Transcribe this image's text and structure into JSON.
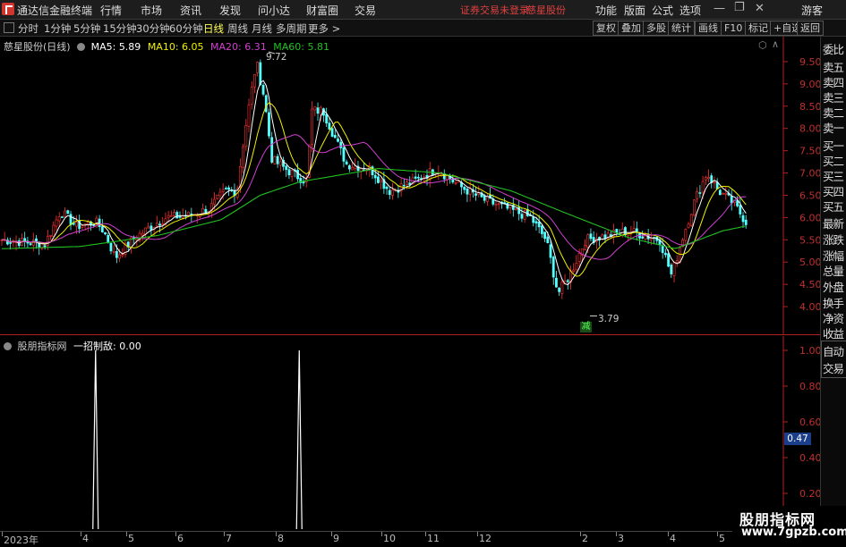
{
  "app": {
    "title": "通达信金融终端"
  },
  "menu": [
    "行情",
    "市场",
    "资讯",
    "发现",
    "问小达",
    "财富圈",
    "交易"
  ],
  "notice": {
    "trade": "证券交易未登录",
    "stock": "慈星股份"
  },
  "right_menu": [
    "功能",
    "版面",
    "公式",
    "选项"
  ],
  "guest": "游客",
  "periods": [
    "分时",
    "1分钟",
    "5分钟",
    "15分钟",
    "30分钟",
    "60分钟",
    "日线",
    "周线",
    "月线",
    "多周期",
    "更多 >"
  ],
  "active_period": "日线",
  "tool_buttons": [
    "复权",
    "叠加",
    "多股",
    "统计",
    "画线",
    "F10",
    "标记",
    "+自选",
    "返回"
  ],
  "right_panel": [
    "委比",
    "卖五",
    "卖四",
    "卖三",
    "卖二",
    "卖一",
    "买一",
    "买二",
    "买三",
    "买四",
    "买五",
    "最新",
    "涨跌",
    "涨幅",
    "总量",
    "外盘",
    "换手",
    "净资",
    "收益",
    "自动",
    "交易"
  ],
  "main_chart": {
    "stock_label": "慈星股份(日线)",
    "ma": [
      {
        "name": "MA5",
        "value": "5.89",
        "color": "#ffffff"
      },
      {
        "name": "MA10",
        "value": "6.05",
        "color": "#f0f000"
      },
      {
        "name": "MA20",
        "value": "6.31",
        "color": "#d040d0"
      },
      {
        "name": "MA60",
        "value": "5.81",
        "color": "#20c020"
      }
    ],
    "price_ticks": [
      "9.50",
      "9.00",
      "8.50",
      "8.00",
      "7.50",
      "7.00",
      "6.50",
      "6.00",
      "5.50",
      "5.00",
      "4.50",
      "4.00"
    ],
    "high_label": "9.72",
    "low_label": "3.79",
    "reduce_mark": "减"
  },
  "sub_chart": {
    "indicator_label": "股朋指标网",
    "formula_label": "一招制敌: 0.00",
    "ticks": [
      "1.00",
      "0.80",
      "0.60",
      "0.40",
      "0.20"
    ],
    "current_value": "0.47"
  },
  "x_axis": [
    "2023年",
    "4",
    "5",
    "6",
    "7",
    "8",
    "9",
    "10",
    "11",
    "12",
    "2",
    "3",
    "4",
    "5"
  ],
  "watermark": {
    "line1": "股朋指标网",
    "line2": "www.7gpzb.com"
  },
  "chart_data": {
    "type": "line",
    "title": "慈星股份(日线)",
    "ylim": [
      3.6,
      9.9
    ],
    "annotations": {
      "high": 9.72,
      "low": 3.79
    },
    "ma_latest": {
      "MA5": 5.89,
      "MA10": 6.05,
      "MA20": 6.31,
      "MA60": 5.81
    },
    "close_path": [
      {
        "x": 0.0,
        "y": 5.5
      },
      {
        "x": 0.03,
        "y": 5.45
      },
      {
        "x": 0.055,
        "y": 5.4
      },
      {
        "x": 0.075,
        "y": 6.15
      },
      {
        "x": 0.095,
        "y": 5.8
      },
      {
        "x": 0.12,
        "y": 5.9
      },
      {
        "x": 0.13,
        "y": 5.7
      },
      {
        "x": 0.145,
        "y": 5.1
      },
      {
        "x": 0.17,
        "y": 5.55
      },
      {
        "x": 0.195,
        "y": 5.85
      },
      {
        "x": 0.21,
        "y": 6.0
      },
      {
        "x": 0.24,
        "y": 6.05
      },
      {
        "x": 0.265,
        "y": 6.2
      },
      {
        "x": 0.285,
        "y": 6.6
      },
      {
        "x": 0.3,
        "y": 6.6
      },
      {
        "x": 0.31,
        "y": 7.9
      },
      {
        "x": 0.325,
        "y": 9.5
      },
      {
        "x": 0.335,
        "y": 8.7
      },
      {
        "x": 0.345,
        "y": 7.3
      },
      {
        "x": 0.37,
        "y": 7.0
      },
      {
        "x": 0.39,
        "y": 6.8
      },
      {
        "x": 0.395,
        "y": 8.4
      },
      {
        "x": 0.41,
        "y": 8.4
      },
      {
        "x": 0.44,
        "y": 7.2
      },
      {
        "x": 0.47,
        "y": 7.1
      },
      {
        "x": 0.495,
        "y": 6.6
      },
      {
        "x": 0.525,
        "y": 6.8
      },
      {
        "x": 0.555,
        "y": 7.1
      },
      {
        "x": 0.585,
        "y": 6.7
      },
      {
        "x": 0.615,
        "y": 6.4
      },
      {
        "x": 0.645,
        "y": 6.2
      },
      {
        "x": 0.675,
        "y": 6.0
      },
      {
        "x": 0.695,
        "y": 5.5
      },
      {
        "x": 0.71,
        "y": 4.3
      },
      {
        "x": 0.725,
        "y": 4.7
      },
      {
        "x": 0.745,
        "y": 5.5
      },
      {
        "x": 0.775,
        "y": 5.6
      },
      {
        "x": 0.8,
        "y": 5.7
      },
      {
        "x": 0.82,
        "y": 5.6
      },
      {
        "x": 0.84,
        "y": 5.5
      },
      {
        "x": 0.855,
        "y": 4.7
      },
      {
        "x": 0.87,
        "y": 5.6
      },
      {
        "x": 0.885,
        "y": 6.4
      },
      {
        "x": 0.9,
        "y": 7.0
      },
      {
        "x": 0.915,
        "y": 6.6
      },
      {
        "x": 0.935,
        "y": 6.3
      },
      {
        "x": 0.95,
        "y": 5.9
      }
    ],
    "ma60_path": [
      {
        "x": 0.0,
        "y": 5.3
      },
      {
        "x": 0.1,
        "y": 5.35
      },
      {
        "x": 0.2,
        "y": 5.6
      },
      {
        "x": 0.28,
        "y": 5.95
      },
      {
        "x": 0.33,
        "y": 6.5
      },
      {
        "x": 0.38,
        "y": 6.8
      },
      {
        "x": 0.48,
        "y": 7.1
      },
      {
        "x": 0.56,
        "y": 7.0
      },
      {
        "x": 0.65,
        "y": 6.6
      },
      {
        "x": 0.72,
        "y": 6.1
      },
      {
        "x": 0.8,
        "y": 5.55
      },
      {
        "x": 0.86,
        "y": 5.3
      },
      {
        "x": 0.92,
        "y": 5.7
      },
      {
        "x": 0.95,
        "y": 5.81
      }
    ],
    "signal_spikes": [
      {
        "x": 0.122,
        "y": 1.0
      },
      {
        "x": 0.382,
        "y": 1.0
      }
    ]
  }
}
